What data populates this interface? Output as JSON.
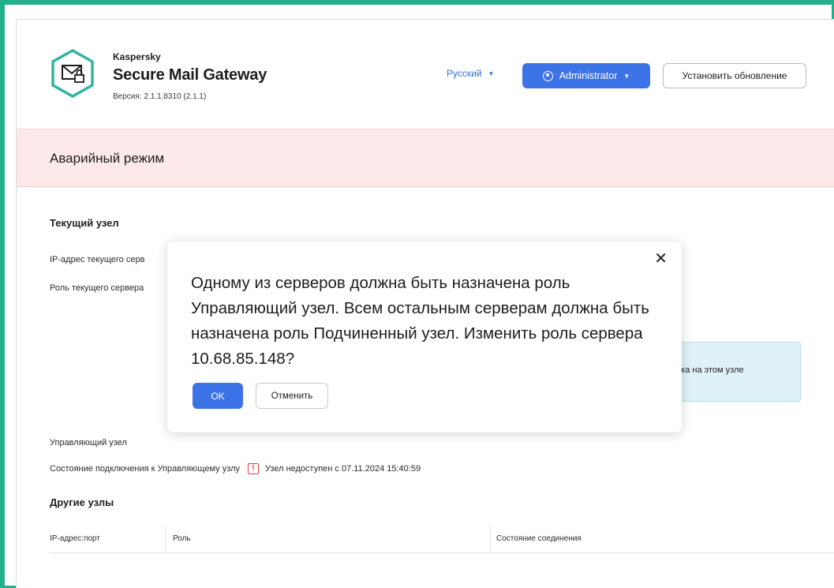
{
  "header": {
    "brand_small": "Kaspersky",
    "brand_title": "Secure Mail Gateway",
    "version": "Версия: 2.1.1.8310 (2.1.1)",
    "language": "Русский",
    "admin_label": "Administrator",
    "update_label": "Установить обновление"
  },
  "emergency": {
    "title": "Аварийный режим"
  },
  "current_node": {
    "title": "Текущий узел",
    "ip_label": "IP-адрес текущего серв",
    "role_label": "Роль текущего сервера",
    "info_text": "ика на этом узле"
  },
  "control_node": {
    "label": "Управляющий узел",
    "connection_label": "Состояние подключения к Управляющему узлу",
    "connection_status": "Узел недоступен с 07.11.2024 15:40:59"
  },
  "other_nodes": {
    "title": "Другие узлы",
    "columns": [
      "IP-адрес:порт",
      "Роль",
      "Состояние соединения"
    ]
  },
  "modal": {
    "message": "Одному из серверов должна быть назначена роль Управляющий узел. Всем остальным серверам должна быть назначена роль Подчиненный узел. Изменить роль сервера 10.68.85.148?",
    "ok_label": "OK",
    "cancel_label": "Отменить"
  },
  "colors": {
    "frame": "#21b08a",
    "accent": "#3c73e6",
    "emergency_bg": "#fde9e9",
    "info_bg": "#dff2f8",
    "warning": "#e23b3b",
    "logo": "#2fb6a0"
  },
  "icons": {
    "logo": "mail-lock-hexagon-icon",
    "admin": "user-circle-icon",
    "close": "close-icon",
    "warning": "alert-square-icon"
  }
}
